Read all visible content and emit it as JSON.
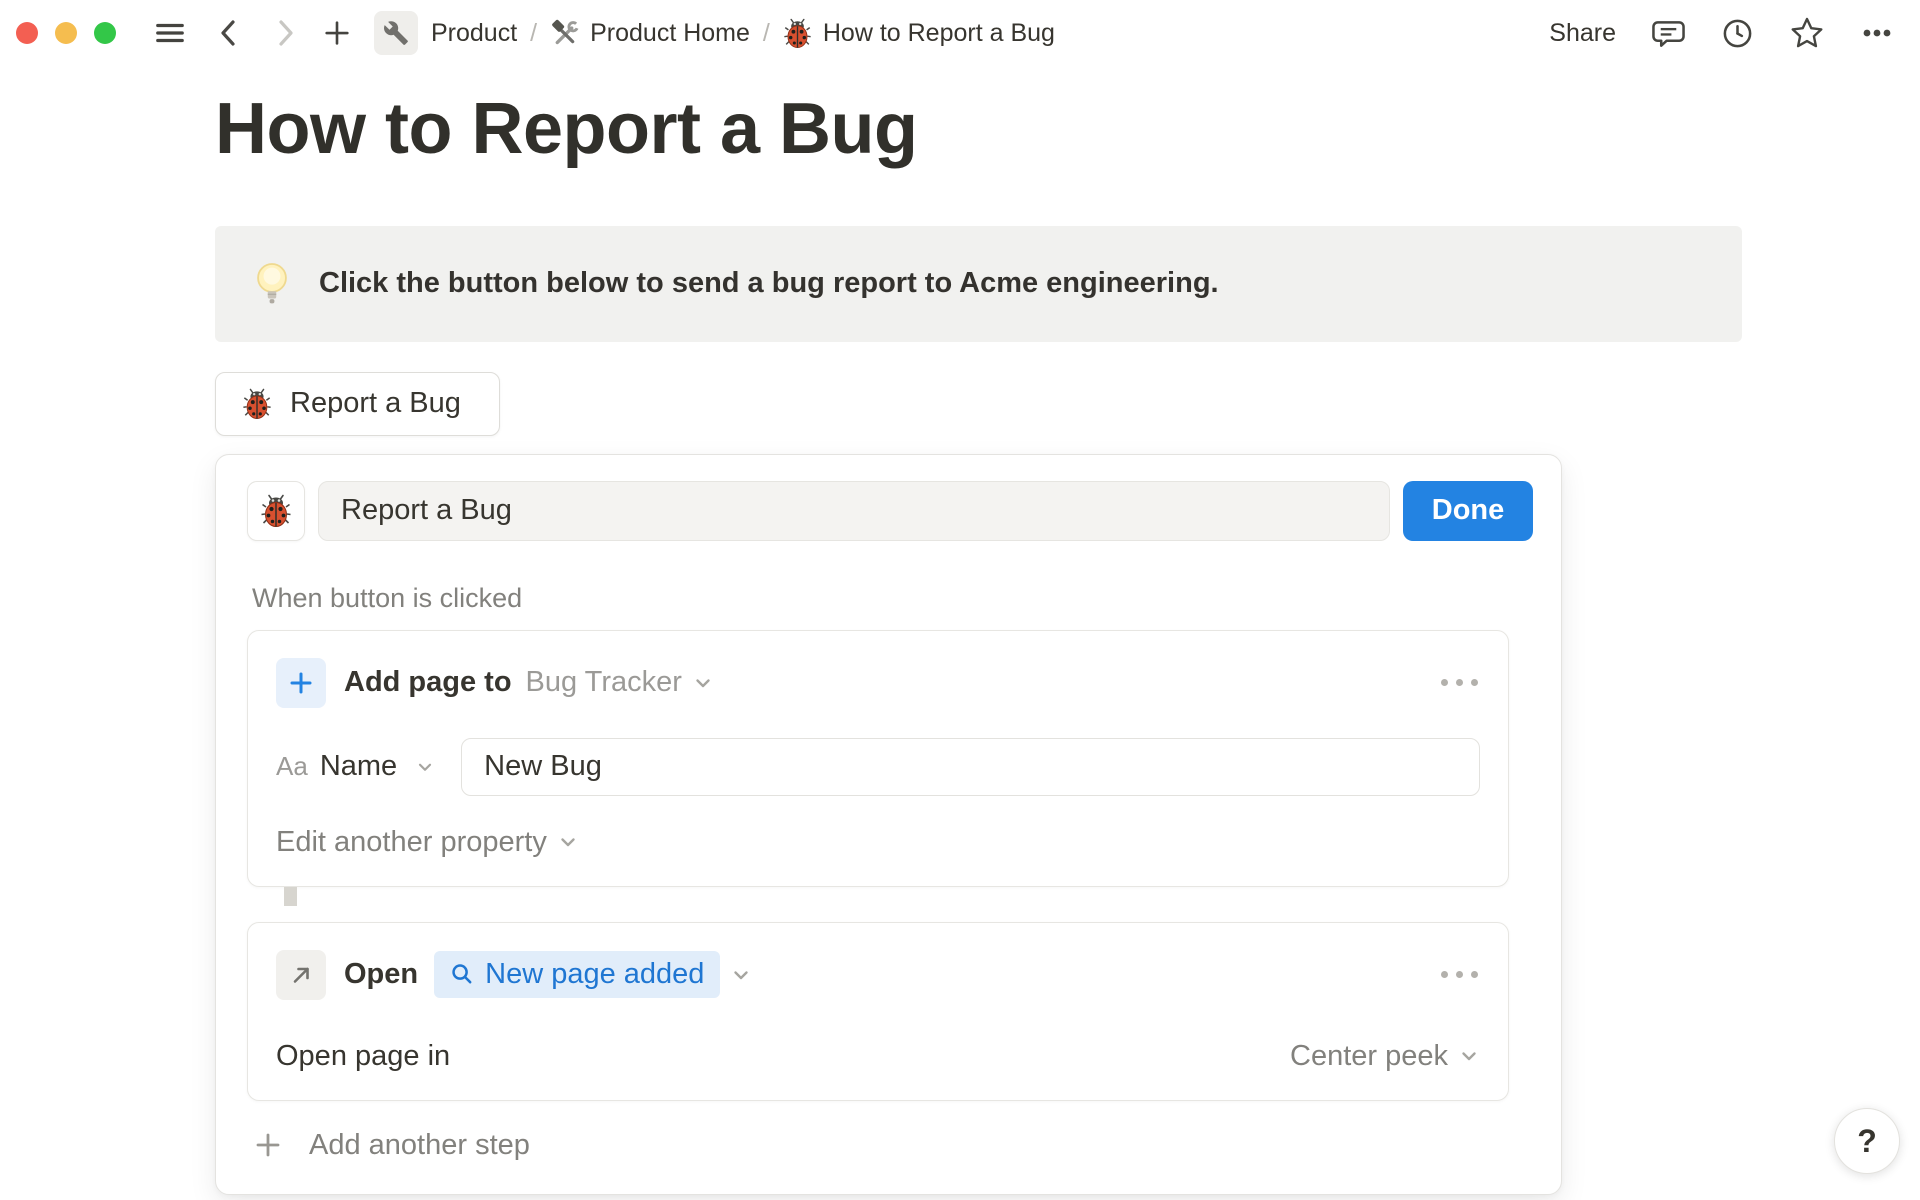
{
  "topbar": {
    "breadcrumb": {
      "separator": "/",
      "items": [
        {
          "label": "Product"
        },
        {
          "label": "Product Home"
        },
        {
          "label": "How to Report a Bug"
        }
      ]
    },
    "share_label": "Share"
  },
  "page": {
    "title": "How to Report a Bug",
    "callout_text": "Click the button below to send a bug report to Acme engineering.",
    "report_button_label": "Report a Bug"
  },
  "editor": {
    "button_name": "Report a Bug",
    "done_label": "Done",
    "trigger_label": "When button is clicked",
    "step1": {
      "action": "Add page to",
      "target": "Bug Tracker",
      "property_type": "Aa",
      "property_name": "Name",
      "property_value": "New Bug",
      "edit_label": "Edit another property"
    },
    "step2": {
      "action": "Open",
      "target": "New page added",
      "open_in_label": "Open page in",
      "open_in_value": "Center peek"
    },
    "add_step_label": "Add another step"
  },
  "help_label": "?",
  "colors": {
    "accent_blue": "#2383E2",
    "link_blue": "#1F76D2",
    "pill_bg": "#E1EDFA",
    "callout_bg": "#F1F1EF",
    "text_primary": "#37352F",
    "text_secondary": "#82817D",
    "text_tertiary": "#9B9A97"
  }
}
